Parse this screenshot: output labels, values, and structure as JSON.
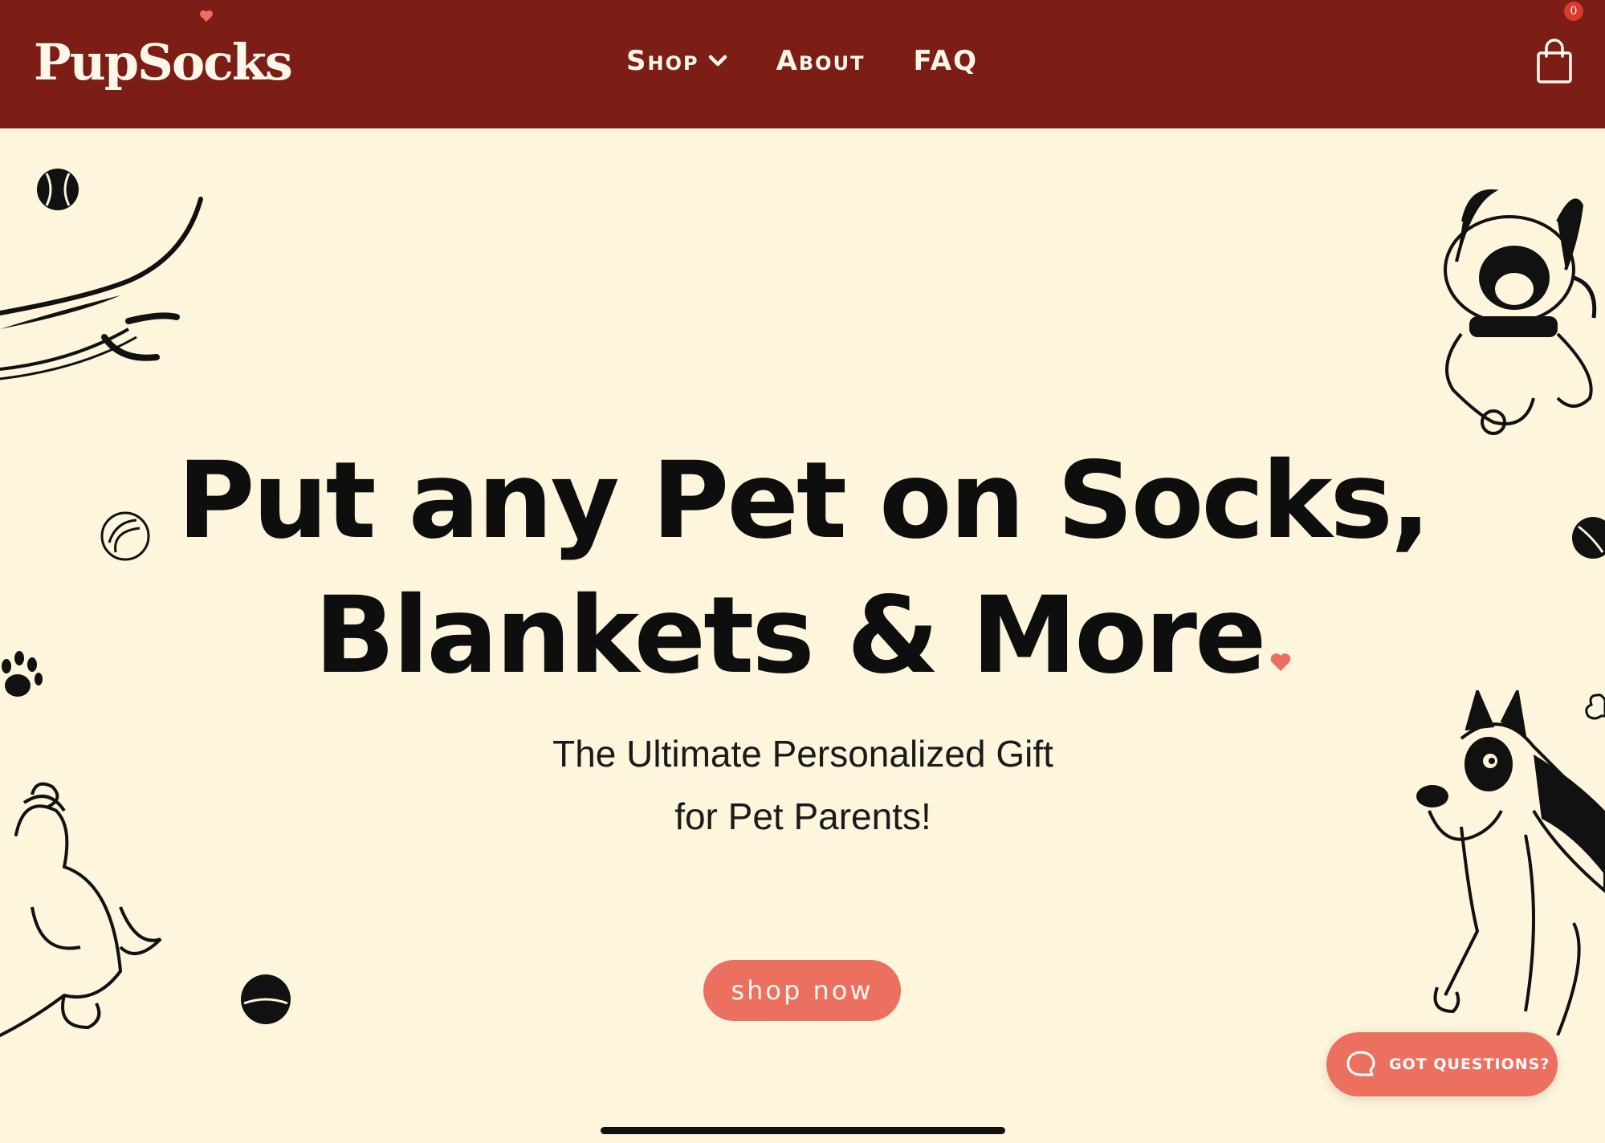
{
  "header": {
    "logo_text": "PupSocks",
    "nav": [
      {
        "label": "Shop",
        "has_dropdown": true
      },
      {
        "label": "About",
        "has_dropdown": false
      },
      {
        "label": "FAQ",
        "has_dropdown": false
      }
    ],
    "cart_count": "0",
    "cart_icon": "shopping-bag-icon",
    "background_color": "#7c1e16"
  },
  "hero": {
    "title_line1": "Put any Pet on Socks,",
    "title_line2": "Blankets & More",
    "subtitle_line1": "The Ultimate Personalized Gift",
    "subtitle_line2": "for Pet Parents!",
    "cta_label": "shop now",
    "background_color": "#fdf5dc",
    "accent_color": "#ec7060"
  },
  "chat_widget": {
    "label": "GOT QUESTIONS?",
    "icon": "chat-bubble-icon"
  }
}
